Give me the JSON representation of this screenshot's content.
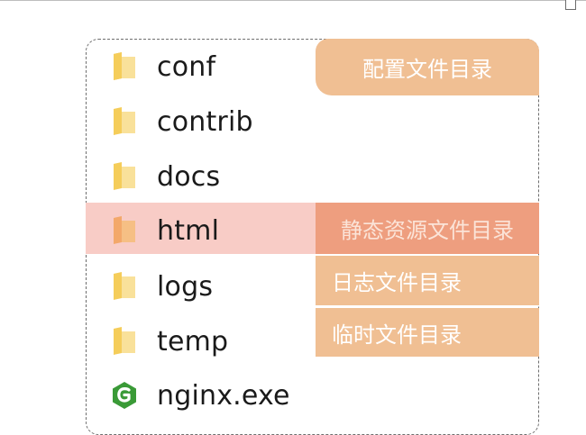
{
  "files": [
    {
      "name": "conf",
      "icon": "folder-icon"
    },
    {
      "name": "contrib",
      "icon": "folder-icon"
    },
    {
      "name": "docs",
      "icon": "folder-icon"
    },
    {
      "name": "html",
      "icon": "folder-icon",
      "highlighted": true
    },
    {
      "name": "logs",
      "icon": "folder-icon"
    },
    {
      "name": "temp",
      "icon": "folder-icon"
    },
    {
      "name": "nginx.exe",
      "icon": "nginx-logo-icon"
    }
  ],
  "annotations": {
    "conf": "配置文件目录",
    "html": "静态资源文件目录",
    "logs": "日志文件目录",
    "temp": "临时文件目录"
  },
  "colors": {
    "folder": "#f5cd5a",
    "folder_highlight": "#f3a86a",
    "annotation_bg": "#f0bf93",
    "annotation_html_bg": "#ee9e7f",
    "row_highlight": "#f8ccc6",
    "nginx_green": "#3a9a37"
  }
}
